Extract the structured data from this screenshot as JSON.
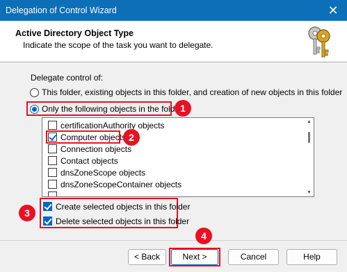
{
  "window": {
    "title": "Delegation of Control Wizard",
    "close_glyph": "✕"
  },
  "header": {
    "title": "Active Directory Object Type",
    "subtitle": "Indicate the scope of the task you want to delegate.",
    "icon": "keys-icon"
  },
  "delegate": {
    "label": "Delegate control of:",
    "options": [
      {
        "label": "This folder, existing objects in this folder, and creation of new objects in this folder",
        "selected": false
      },
      {
        "label": "Only the following objects in the folder:",
        "selected": true
      }
    ]
  },
  "object_list": {
    "items": [
      {
        "label": "certificationAuthority objects",
        "checked": false
      },
      {
        "label": "Computer objects",
        "checked": true
      },
      {
        "label": "Connection objects",
        "checked": false
      },
      {
        "label": "Contact objects",
        "checked": false
      },
      {
        "label": "dnsZoneScope objects",
        "checked": false
      },
      {
        "label": "dnsZoneScopeContainer objects",
        "checked": false
      }
    ]
  },
  "create_delete": {
    "create": {
      "label": "Create selected objects in this folder",
      "checked": true
    },
    "delete": {
      "label": "Delete selected objects in this folder",
      "checked": true
    }
  },
  "annotations": [
    "1",
    "2",
    "3",
    "4"
  ],
  "buttons": {
    "back": "< Back",
    "next": "Next >",
    "cancel": "Cancel",
    "help": "Help"
  },
  "colors": {
    "accent": "#0067c0",
    "annotation": "#e81123",
    "titlebar": "#0c6fb8"
  }
}
